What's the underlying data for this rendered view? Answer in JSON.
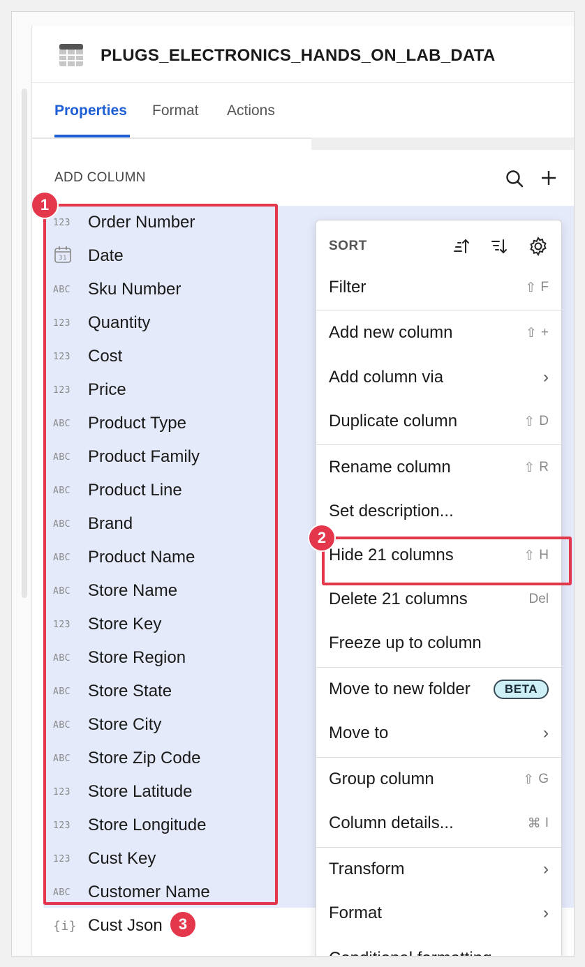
{
  "table_title": "PLUGS_ELECTRONICS_HANDS_ON_LAB_DATA",
  "tabs": [
    {
      "label": "Properties",
      "active": true
    },
    {
      "label": "Format",
      "active": false
    },
    {
      "label": "Actions",
      "active": false
    }
  ],
  "section_label": "ADD COLUMN",
  "columns": [
    {
      "type": "123",
      "name": "Order Number"
    },
    {
      "type": "date",
      "name": "Date"
    },
    {
      "type": "ABC",
      "name": "Sku Number"
    },
    {
      "type": "123",
      "name": "Quantity"
    },
    {
      "type": "123",
      "name": "Cost"
    },
    {
      "type": "123",
      "name": "Price"
    },
    {
      "type": "ABC",
      "name": "Product Type"
    },
    {
      "type": "ABC",
      "name": "Product Family"
    },
    {
      "type": "ABC",
      "name": "Product Line"
    },
    {
      "type": "ABC",
      "name": "Brand"
    },
    {
      "type": "ABC",
      "name": "Product Name"
    },
    {
      "type": "ABC",
      "name": "Store Name"
    },
    {
      "type": "123",
      "name": "Store Key"
    },
    {
      "type": "ABC",
      "name": "Store Region"
    },
    {
      "type": "ABC",
      "name": "Store State"
    },
    {
      "type": "ABC",
      "name": "Store City"
    },
    {
      "type": "ABC",
      "name": "Store Zip Code"
    },
    {
      "type": "123",
      "name": "Store Latitude"
    },
    {
      "type": "123",
      "name": "Store Longitude"
    },
    {
      "type": "123",
      "name": "Cust Key"
    },
    {
      "type": "ABC",
      "name": "Customer Name"
    },
    {
      "type": "json",
      "name": "Cust Json"
    }
  ],
  "calendar_icon_text": "31",
  "json_icon_text": "{i}",
  "badges": [
    "1",
    "2",
    "3"
  ],
  "menu": {
    "sort_label": "SORT",
    "filter": {
      "label": "Filter",
      "shortcut": "F"
    },
    "add_new_column": {
      "label": "Add new column",
      "shortcut": "+"
    },
    "add_column_via": {
      "label": "Add column via"
    },
    "duplicate_column": {
      "label": "Duplicate column",
      "shortcut": "D"
    },
    "rename_column": {
      "label": "Rename column",
      "shortcut": "R"
    },
    "set_description": {
      "label": "Set description..."
    },
    "hide_columns": {
      "label": "Hide 21 columns",
      "shortcut": "H"
    },
    "delete_columns": {
      "label": "Delete 21 columns",
      "shortcut": "Del"
    },
    "freeze": {
      "label": "Freeze up to column"
    },
    "move_new_folder": {
      "label": "Move to new folder",
      "badge": "BETA"
    },
    "move_to": {
      "label": "Move to"
    },
    "group_column": {
      "label": "Group column",
      "shortcut": "G"
    },
    "column_details": {
      "label": "Column details...",
      "shortcut": "I"
    },
    "transform": {
      "label": "Transform"
    },
    "format": {
      "label": "Format"
    },
    "conditional_formatting": {
      "label": "Conditional formatting"
    }
  },
  "colors": {
    "accent": "#1f5fd6",
    "highlight": "#e5374b",
    "selection": "#e4eafa"
  }
}
